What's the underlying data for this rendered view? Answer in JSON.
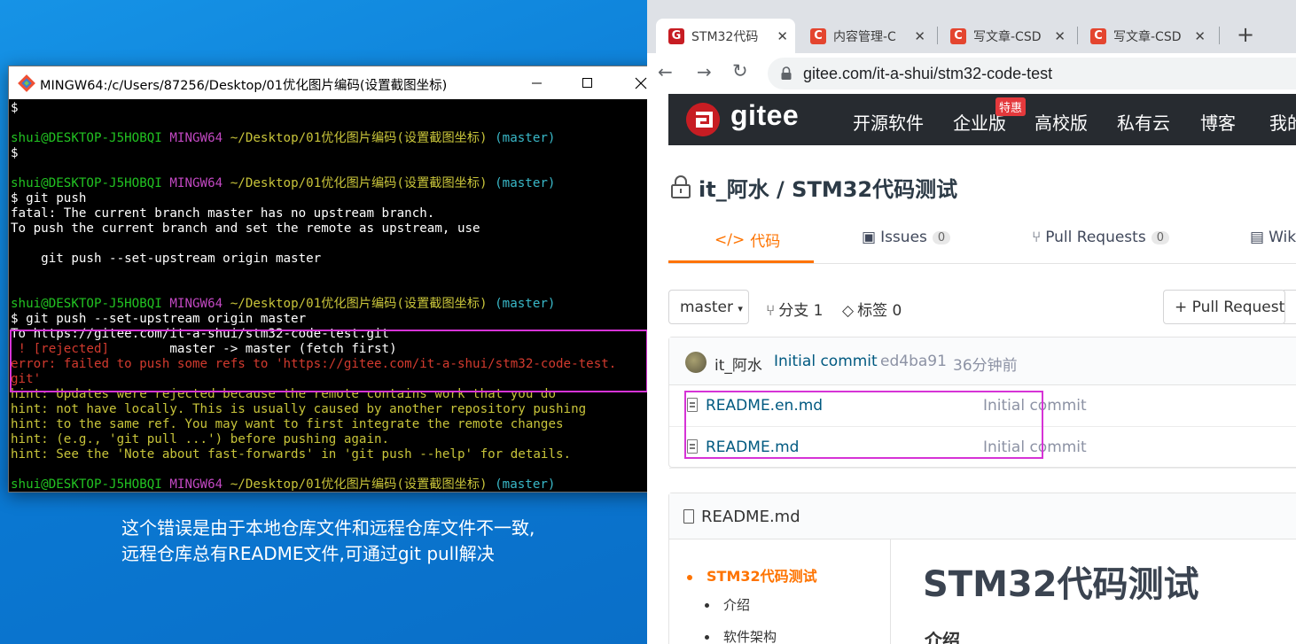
{
  "desktop": {
    "caption_line1": "这个错误是由于本地仓库文件和远程仓库文件不一致,",
    "caption_line2": "远程仓库总有README文件,可通过git pull解决"
  },
  "terminal": {
    "title": "MINGW64:/c/Users/87256/Desktop/01优化图片编码(设置截图坐标)",
    "prompt_user": "shui@DESKTOP-J5HOBQI",
    "prompt_shell": "MINGW64",
    "prompt_path": "~/Desktop/01优化图片编码(设置截图坐标)",
    "prompt_branch": "(master)",
    "lines": {
      "l01": "$",
      "l03": "$",
      "l05": "$ git push",
      "l06": "fatal: The current branch master has no upstream branch.",
      "l07": "To push the current branch and set the remote as upstream, use",
      "l09": "    git push --set-upstream origin master",
      "l13": "$ git push --set-upstream origin master",
      "l14": "To https://gitee.com/it-a-shui/stm32-code-test.git",
      "l15a": " ! [rejected]",
      "l15b": "        master -> master (fetch first)",
      "l16": "error: failed to push some refs to 'https://gitee.com/it-a-shui/stm32-code-test.",
      "l17": "git'",
      "l18": "hint: Updates were rejected because the remote contains work that you do",
      "l19": "hint: not have locally. This is usually caused by another repository pushing",
      "l20": "hint: to the same ref. You may want to first integrate the remote changes",
      "l21": "hint: (e.g., 'git pull ...') before pushing again.",
      "l22": "hint: See the 'Note about fast-forwards' in 'git push --help' for details."
    }
  },
  "browser": {
    "tabs": [
      {
        "label": "STM32代码",
        "favicon": "G"
      },
      {
        "label": "内容管理-C",
        "favicon": "C"
      },
      {
        "label": "写文章-CSD",
        "favicon": "C"
      },
      {
        "label": "写文章-CSD",
        "favicon": "C"
      }
    ],
    "url": "gitee.com/it-a-shui/stm32-code-test"
  },
  "gitee": {
    "wordmark": "gitee",
    "nav": [
      "开源软件",
      "企业版",
      "高校版",
      "私有云",
      "博客",
      "我的"
    ],
    "nav_badge": "特惠",
    "repo_title": "it_阿水 / STM32代码测试",
    "tabs": {
      "code": "代码",
      "issues": "Issues",
      "issues_count": "0",
      "pulls": "Pull Requests",
      "pulls_count": "0",
      "wiki": "Wiki"
    },
    "branch": "master",
    "branch_label": "分支 1",
    "tag_label": "标签 0",
    "pr_button": "+ Pull Request",
    "commit": {
      "author": "it_阿水",
      "message": "Initial commit",
      "sha": "ed4ba91",
      "time": "36分钟前"
    },
    "files": [
      {
        "name": "README.en.md",
        "commit": "Initial commit"
      },
      {
        "name": "README.md",
        "commit": "Initial commit"
      }
    ],
    "readme": {
      "header": "README.md",
      "toc": [
        "STM32代码测试",
        "介绍",
        "软件架构"
      ],
      "h1": "STM32代码测试",
      "h2": "介绍"
    }
  },
  "colors": {
    "gitee_orange": "#fe7300",
    "gitee_red": "#c71d23",
    "highlight_magenta": "#d633d6",
    "terminal_green": "#22c322",
    "terminal_red": "#d23a2e"
  }
}
